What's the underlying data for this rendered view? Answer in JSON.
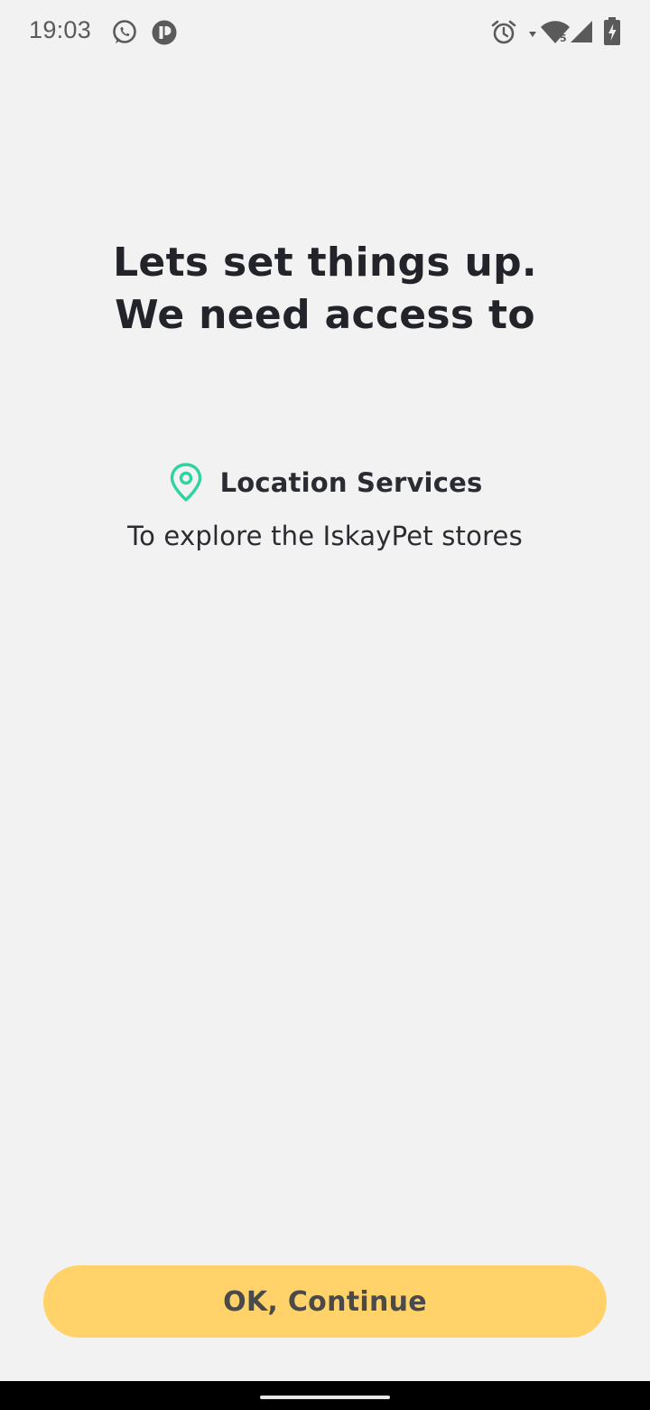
{
  "status_bar": {
    "time": "19:03",
    "icons": [
      "whatsapp-icon",
      "app-notification-icon",
      "alarm-icon",
      "data-arrow-icon",
      "wifi-icon",
      "signal-icon",
      "battery-charging-icon"
    ]
  },
  "heading": {
    "line1": "Lets set things up.",
    "line2": "We need access to"
  },
  "permission": {
    "icon": "location-pin-icon",
    "title": "Location Services",
    "description": "To explore the IskayPet stores"
  },
  "button": {
    "label": "OK, Continue"
  },
  "colors": {
    "background": "#f2f2f2",
    "accent_button": "#ffd36a",
    "location_icon": "#2fd3a0",
    "text": "#22242a"
  }
}
